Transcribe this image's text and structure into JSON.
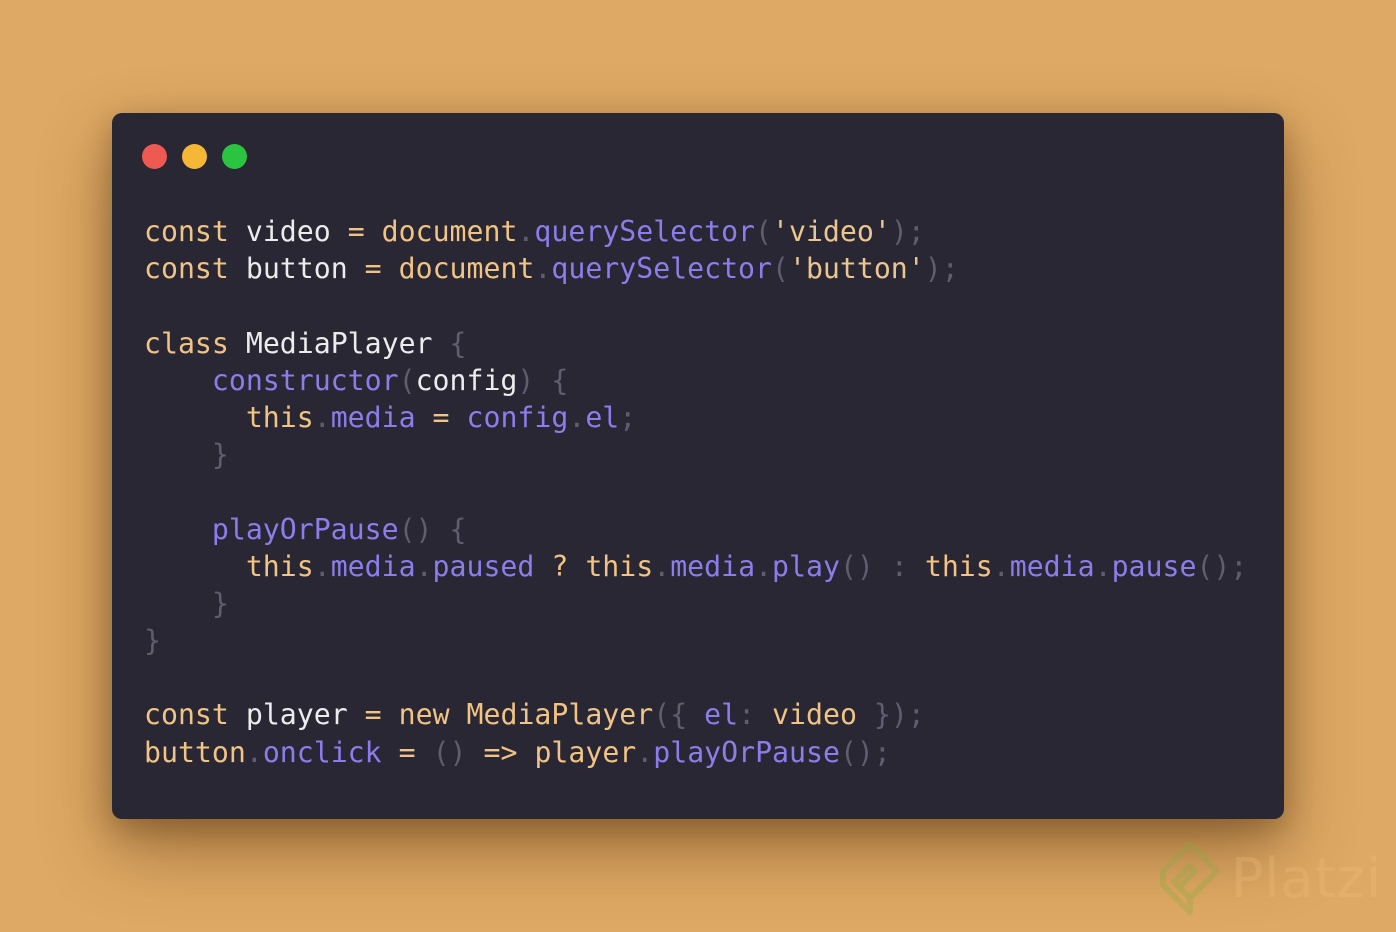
{
  "window": {
    "controls": [
      {
        "name": "close",
        "color": "#ee5a52"
      },
      {
        "name": "minimize",
        "color": "#f5b836"
      },
      {
        "name": "maximize",
        "color": "#2bc440"
      }
    ]
  },
  "colors": {
    "background": "#dea964",
    "window": "#282733",
    "keyword": "#f1c384",
    "identifier": "#ececec",
    "property": "#8d7dea",
    "string": "#ecc690",
    "punctuation": "#5f5d70",
    "operator": "#f1c384"
  },
  "code_lines": [
    [
      [
        "keyword",
        "const"
      ],
      [
        "plain",
        " "
      ],
      [
        "ident",
        "video"
      ],
      [
        "plain",
        " "
      ],
      [
        "op",
        "="
      ],
      [
        "plain",
        " "
      ],
      [
        "keyword",
        "document"
      ],
      [
        "punct",
        "."
      ],
      [
        "prop",
        "querySelector"
      ],
      [
        "punct",
        "("
      ],
      [
        "string",
        "'video'"
      ],
      [
        "punct",
        ");"
      ]
    ],
    [
      [
        "keyword",
        "const"
      ],
      [
        "plain",
        " "
      ],
      [
        "ident",
        "button"
      ],
      [
        "plain",
        " "
      ],
      [
        "op",
        "="
      ],
      [
        "plain",
        " "
      ],
      [
        "keyword",
        "document"
      ],
      [
        "punct",
        "."
      ],
      [
        "prop",
        "querySelector"
      ],
      [
        "punct",
        "("
      ],
      [
        "string",
        "'button'"
      ],
      [
        "punct",
        ");"
      ]
    ],
    [],
    [
      [
        "keyword",
        "class"
      ],
      [
        "plain",
        " "
      ],
      [
        "ident",
        "MediaPlayer"
      ],
      [
        "plain",
        " "
      ],
      [
        "punct",
        "{"
      ]
    ],
    [
      [
        "plain",
        "    "
      ],
      [
        "prop",
        "constructor"
      ],
      [
        "punct",
        "("
      ],
      [
        "ident",
        "config"
      ],
      [
        "punct",
        ")"
      ],
      [
        "plain",
        " "
      ],
      [
        "punct",
        "{"
      ]
    ],
    [
      [
        "plain",
        "      "
      ],
      [
        "keyword",
        "this"
      ],
      [
        "punct",
        "."
      ],
      [
        "prop",
        "media"
      ],
      [
        "plain",
        " "
      ],
      [
        "op",
        "="
      ],
      [
        "plain",
        " "
      ],
      [
        "prop",
        "config"
      ],
      [
        "punct",
        "."
      ],
      [
        "prop",
        "el"
      ],
      [
        "punct",
        ";"
      ]
    ],
    [
      [
        "plain",
        "    "
      ],
      [
        "punct",
        "}"
      ]
    ],
    [],
    [
      [
        "plain",
        "    "
      ],
      [
        "prop",
        "playOrPause"
      ],
      [
        "punct",
        "()"
      ],
      [
        "plain",
        " "
      ],
      [
        "punct",
        "{"
      ]
    ],
    [
      [
        "plain",
        "      "
      ],
      [
        "keyword",
        "this"
      ],
      [
        "punct",
        "."
      ],
      [
        "prop",
        "media"
      ],
      [
        "punct",
        "."
      ],
      [
        "prop",
        "paused"
      ],
      [
        "plain",
        " "
      ],
      [
        "op",
        "?"
      ],
      [
        "plain",
        " "
      ],
      [
        "keyword",
        "this"
      ],
      [
        "punct",
        "."
      ],
      [
        "prop",
        "media"
      ],
      [
        "punct",
        "."
      ],
      [
        "prop",
        "play"
      ],
      [
        "punct",
        "()"
      ],
      [
        "plain",
        " "
      ],
      [
        "punct",
        ":"
      ],
      [
        "plain",
        " "
      ],
      [
        "keyword",
        "this"
      ],
      [
        "punct",
        "."
      ],
      [
        "prop",
        "media"
      ],
      [
        "punct",
        "."
      ],
      [
        "prop",
        "pause"
      ],
      [
        "punct",
        "();"
      ]
    ],
    [
      [
        "plain",
        "    "
      ],
      [
        "punct",
        "}"
      ]
    ],
    [
      [
        "punct",
        "}"
      ]
    ],
    [],
    [
      [
        "keyword",
        "const"
      ],
      [
        "plain",
        " "
      ],
      [
        "ident",
        "player"
      ],
      [
        "plain",
        " "
      ],
      [
        "op",
        "="
      ],
      [
        "plain",
        " "
      ],
      [
        "keyword",
        "new"
      ],
      [
        "plain",
        " "
      ],
      [
        "keyword",
        "MediaPlayer"
      ],
      [
        "punct",
        "({"
      ],
      [
        "plain",
        " "
      ],
      [
        "prop",
        "el"
      ],
      [
        "punct",
        ":"
      ],
      [
        "plain",
        " "
      ],
      [
        "keyword",
        "video"
      ],
      [
        "plain",
        " "
      ],
      [
        "punct",
        "});"
      ]
    ],
    [
      [
        "keyword",
        "button"
      ],
      [
        "punct",
        "."
      ],
      [
        "prop",
        "onclick"
      ],
      [
        "plain",
        " "
      ],
      [
        "op",
        "="
      ],
      [
        "plain",
        " "
      ],
      [
        "punct",
        "()"
      ],
      [
        "plain",
        " "
      ],
      [
        "op",
        "=>"
      ],
      [
        "plain",
        " "
      ],
      [
        "keyword",
        "player"
      ],
      [
        "punct",
        "."
      ],
      [
        "prop",
        "playOrPause"
      ],
      [
        "punct",
        "();"
      ]
    ]
  ],
  "watermark": {
    "text": "Platzi",
    "icon": "platzi-logo-icon"
  }
}
